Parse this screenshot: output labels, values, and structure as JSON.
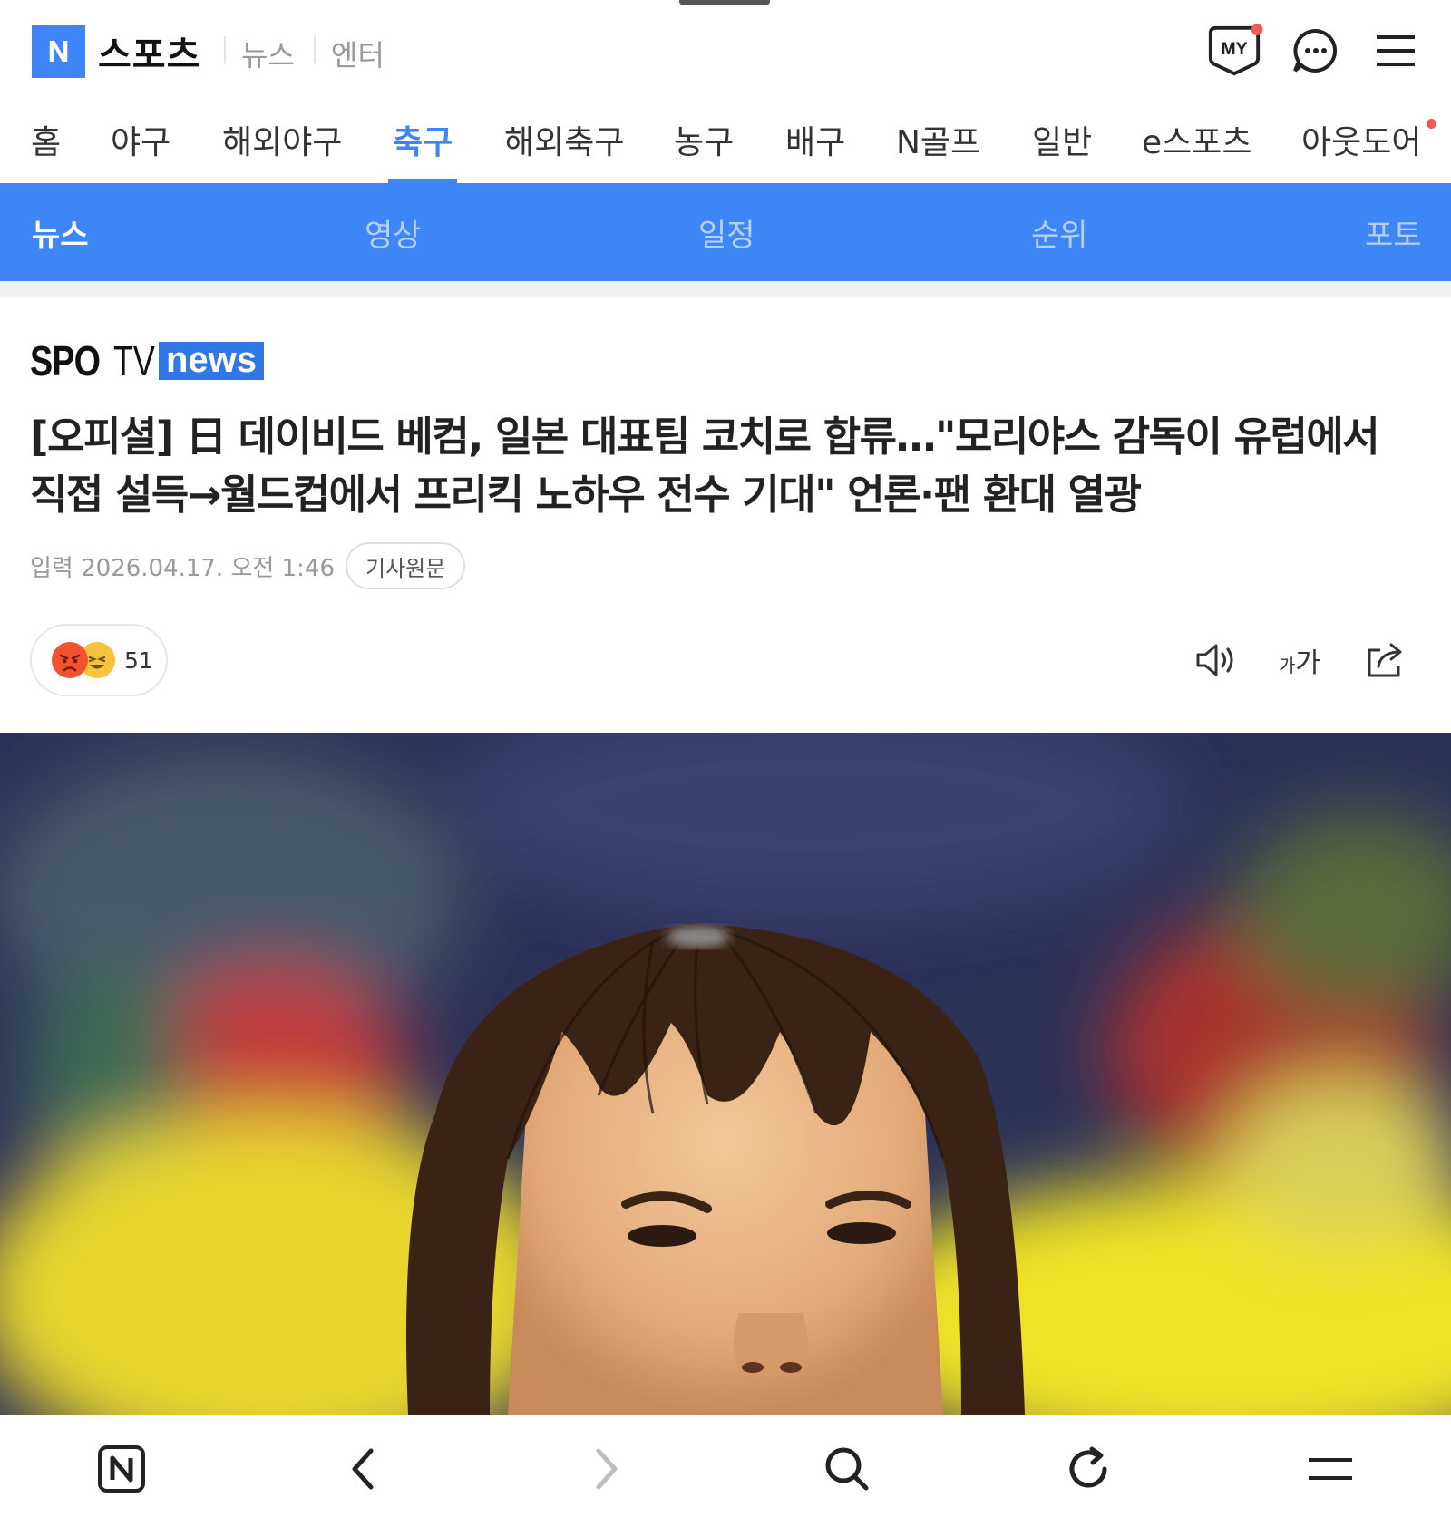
{
  "header": {
    "logo_letter": "N",
    "service_title": "스포츠",
    "top_links": [
      "뉴스",
      "엔터"
    ],
    "icons": [
      "my-icon",
      "chat-icon",
      "menu-icon"
    ],
    "my_badge_text": "MY"
  },
  "categories": {
    "items": [
      "홈",
      "야구",
      "해외야구",
      "축구",
      "해외축구",
      "농구",
      "배구",
      "N골프",
      "일반",
      "e스포츠",
      "아웃도어"
    ],
    "active": "축구"
  },
  "subnav": {
    "items": [
      "뉴스",
      "영상",
      "일정",
      "순위",
      "포토"
    ],
    "active": "뉴스"
  },
  "article": {
    "press": {
      "spo": "SPO",
      "tv": "TV",
      "news": "news"
    },
    "headline": "[오피셜] 日 데이비드 베컴, 일본 대표팀 코치로 합류…\"모리야스 감독이 유럽에서 직접 설득→월드컵에서 프리킥 노하우 전수 기대\" 언론·팬 환대 열광",
    "date": "입력 2026.04.17. 오전 1:46",
    "original_button": "기사원문",
    "reaction_count": "51",
    "font_size_label": {
      "small": "가",
      "large": "가"
    }
  },
  "bottom_bar": {
    "icons": [
      "naver-home-icon",
      "back-icon",
      "forward-icon",
      "search-icon",
      "refresh-icon",
      "browser-menu-icon"
    ]
  },
  "colors": {
    "brand_blue": "#3e85f5",
    "notification_red": "#f05a4f"
  }
}
